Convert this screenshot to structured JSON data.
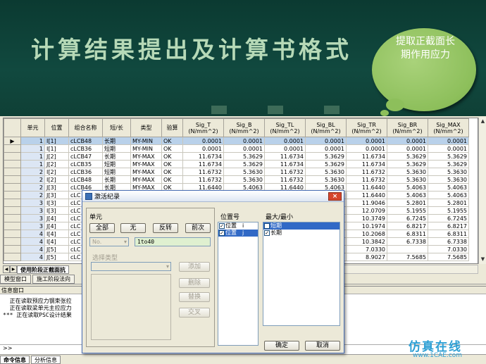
{
  "slide": {
    "title": "计算结果提出及计算书格式",
    "callout": "提取正截面长期作用应力"
  },
  "grid": {
    "headers": [
      "单元",
      "位置",
      "组合名称",
      "短/长",
      "类型",
      "验算",
      "Sig_T\n(N/mm^2)",
      "Sig_B\n(N/mm^2)",
      "Sig_TL\n(N/mm^2)",
      "Sig_BL\n(N/mm^2)",
      "Sig_TR\n(N/mm^2)",
      "Sig_BR\n(N/mm^2)",
      "Sig_MAX\n(N/mm^2)"
    ],
    "rows": [
      [
        "1",
        "I[1]",
        "cLCB48",
        "长期",
        "MY-MIN",
        "OK",
        "0.0001",
        "0.0001",
        "0.0001",
        "0.0001",
        "0.0001",
        "0.0001",
        "0.0001"
      ],
      [
        "1",
        "I[1]",
        "cLCB36",
        "短期",
        "MY-MIN",
        "OK",
        "0.0001",
        "0.0001",
        "0.0001",
        "0.0001",
        "0.0001",
        "0.0001",
        "0.0001"
      ],
      [
        "1",
        "J[2]",
        "cLCB47",
        "长期",
        "MY-MAX",
        "OK",
        "11.6734",
        "5.3629",
        "11.6734",
        "5.3629",
        "11.6734",
        "5.3629",
        "5.3629"
      ],
      [
        "1",
        "J[2]",
        "cLCB35",
        "短期",
        "MY-MAX",
        "OK",
        "11.6734",
        "5.3629",
        "11.6734",
        "5.3629",
        "11.6734",
        "5.3629",
        "5.3629"
      ],
      [
        "2",
        "I[2]",
        "cLCB36",
        "短期",
        "MY-MAX",
        "OK",
        "11.6732",
        "5.3630",
        "11.6732",
        "5.3630",
        "11.6732",
        "5.3630",
        "5.3630"
      ],
      [
        "2",
        "I[2]",
        "cLCB48",
        "长期",
        "MY-MAX",
        "OK",
        "11.6732",
        "5.3630",
        "11.6732",
        "5.3630",
        "11.6732",
        "5.3630",
        "5.3630"
      ],
      [
        "2",
        "J[3]",
        "cLCB46",
        "长期",
        "MY-MAX",
        "OK",
        "11.6440",
        "5.4063",
        "11.6440",
        "5.4063",
        "11.6440",
        "5.4063",
        "5.4063"
      ],
      [
        "2",
        "J[3]",
        "cLC",
        "",
        "",
        "",
        "",
        "",
        "",
        "5.4063",
        "11.6440",
        "5.4063",
        "5.4063"
      ],
      [
        "3",
        "I[3]",
        "cLC",
        "",
        "",
        "",
        "",
        "",
        "",
        "5.2801",
        "11.9046",
        "5.2801",
        "5.2801"
      ],
      [
        "3",
        "I[3]",
        "cLC",
        "",
        "",
        "",
        "",
        "",
        "",
        "5.1955",
        "12.0709",
        "5.1955",
        "5.1955"
      ],
      [
        "3",
        "J[4]",
        "cLC",
        "",
        "",
        "",
        "",
        "",
        "",
        "6.7245",
        "10.3749",
        "6.7245",
        "6.7245"
      ],
      [
        "3",
        "J[4]",
        "cLC",
        "",
        "",
        "",
        "",
        "",
        "",
        "6.8217",
        "10.1974",
        "6.8217",
        "6.8217"
      ],
      [
        "4",
        "I[4]",
        "cLC",
        "",
        "",
        "",
        "",
        "",
        "",
        "6.8311",
        "10.2068",
        "6.8311",
        "6.8311"
      ],
      [
        "4",
        "I[4]",
        "cLC",
        "",
        "",
        "",
        "",
        "",
        "",
        "6.7338",
        "10.3842",
        "6.7338",
        "6.7338"
      ],
      [
        "4",
        "J[5]",
        "cLC",
        "",
        "",
        "",
        "",
        "",
        "",
        "7.0330",
        "7.0330",
        "",
        "7.0330"
      ],
      [
        "4",
        "J[5]",
        "cLC",
        "",
        "",
        "",
        "",
        "",
        "",
        "7.5685",
        "8.9027",
        "7.5685",
        "7.5685"
      ]
    ],
    "sheet_tab": "使用阶段正截面抗",
    "doc_tabs": [
      "模型窗口",
      "施工阶段法向"
    ]
  },
  "info": {
    "title": "信息窗口",
    "lines": [
      "  正在读取预应力钢束张拉",
      "  正在读取梁单元主拉应力",
      "*** 正在读取PSC设计结果"
    ],
    "cmd_prompt": ">>",
    "tabs": [
      "命令信息",
      "分析信息"
    ]
  },
  "dialog": {
    "title": "激活纪录",
    "close": "×",
    "unit_group": "单元",
    "btn_all": "全部",
    "btn_none": "无",
    "btn_invert": "反转",
    "btn_prev": "前次",
    "no_select": "No.",
    "range_value": "1to40",
    "sel_type_label": "选择类型",
    "btn_add": "添加",
    "btn_delete": "删除",
    "btn_replace": "替换",
    "btn_intersect": "交叉",
    "pos_label": "位置号",
    "pos_items": [
      "位置",
      "i",
      "位置",
      "j"
    ],
    "maxmin_label": "最大/最小",
    "maxmin_items": [
      "短期",
      "长期"
    ],
    "btn_ok": "确定",
    "btn_cancel": "取消"
  },
  "watermark": "仿真在线",
  "watermark_url": "www.1CAE.com"
}
